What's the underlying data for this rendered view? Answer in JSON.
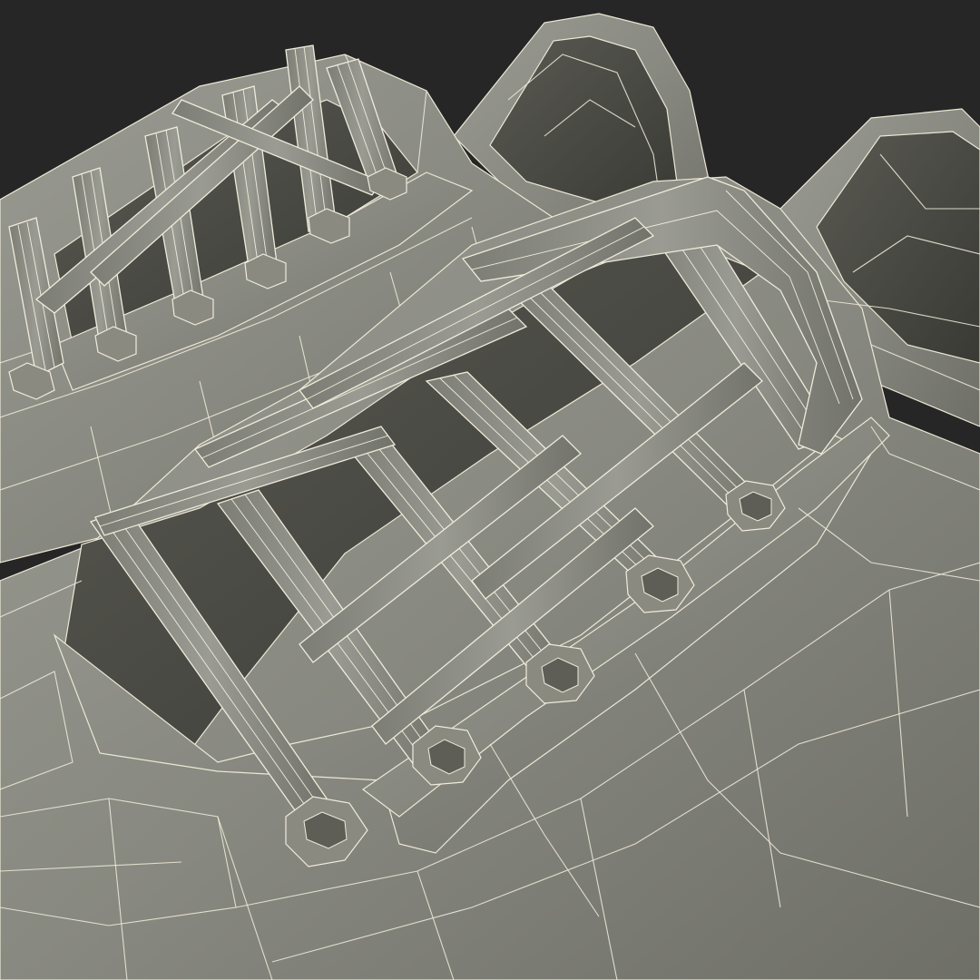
{
  "scene": {
    "subject": "wireframe-sneaker-pair",
    "render_style": "wireframe-on-shaded",
    "background_color": "#262626",
    "mesh_color": "#8e8f86",
    "wire_color": "#ece8d6",
    "inner_color": "#4a4a44"
  }
}
